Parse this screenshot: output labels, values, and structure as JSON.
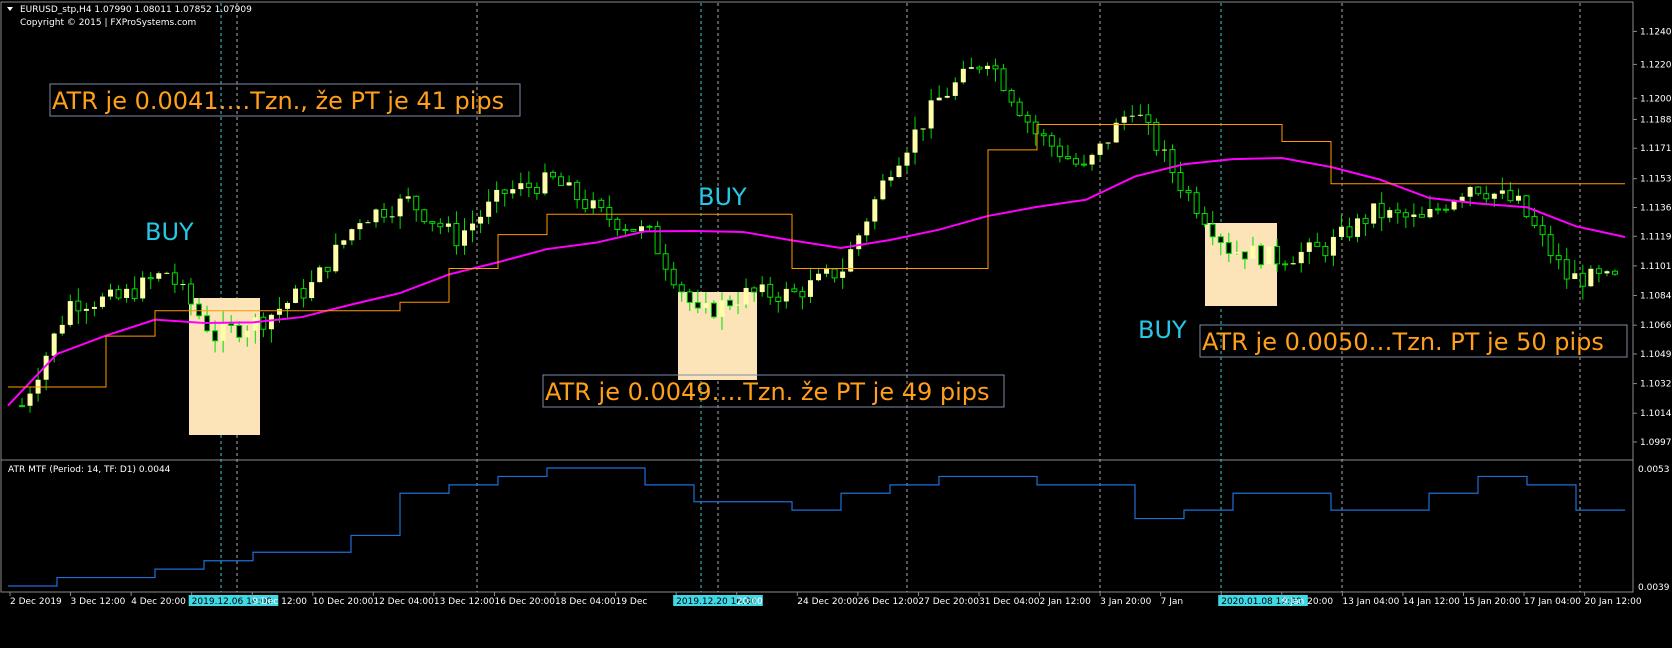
{
  "window": {
    "header": "EURUSD_stp,H4  1.07990 1.08011 1.07852 1.07909",
    "copyright": "Copyright © 2015 | FXProSystems.com"
  },
  "annotations": {
    "atr1": "ATR je 0.0041….Tzn., že PT je 41 pips",
    "atr2": "ATR je 0.0049….Tzn. že PT je 49 pips",
    "atr3": "ATR je 0.0050…Tzn. PT je 50  pips",
    "buy1": "BUY",
    "buy2": "BUY",
    "buy3": "BUY"
  },
  "indicator": {
    "title": "ATR MTF (Period: 14, TF: D1) 0.0044",
    "axis_top": "0.0053",
    "axis_bottom": "0.0039"
  },
  "colors": {
    "background": "#000000",
    "bull_candle": "#ffffaa",
    "wick": "#00dd00",
    "ma_line": "#ff00ff",
    "stop_line": "#ff9900",
    "atr_line": "#1e6fd9",
    "label_orange": "#ff9f1a",
    "label_cyan": "#27c7e8",
    "box_fill": "#fde3b8",
    "grid_cyan": "#3fd0d0",
    "grid_white": "#cccccc"
  },
  "x_axis": {
    "labels": [
      "2 Dec 2019",
      "3 Dec 12:00",
      "4 Dec 20:00",
      "2019.12.06 16:00",
      "9 Dec 12:00",
      "10 Dec 20:00",
      "12 Dec 04:00",
      "13 Dec 12:00",
      "16 Dec 20:00",
      "18 Dec 04:00",
      "19 Dec",
      "2019.12.20 16:00",
      "20:00",
      "24 Dec 20:00",
      "26 Dec 12:00",
      "27 Dec 20:00",
      "31 Dec 04:00",
      "2 Jan 12:00",
      "3 Jan 20:00",
      "7 Jan",
      "2020.01.08 12:00",
      "9 Jan 20:00",
      "13 Jan 04:00",
      "14 Jan 12:00",
      "15 Jan 20:00",
      "17 Jan 04:00",
      "20 Jan 12:00"
    ],
    "highlighted": [
      "2019.12.06 16:00",
      "2019.12.20 16:00",
      "2020.01.08 12:00"
    ]
  },
  "y_axis": {
    "labels": [
      "1.12400",
      "1.12205",
      "1.12005",
      "1.11880",
      "1.11710",
      "1.11530",
      "1.11360",
      "1.11190",
      "1.11015",
      "1.10840",
      "1.10665",
      "1.10495",
      "1.10320",
      "1.10145",
      "1.09975"
    ]
  },
  "chart_data": [
    {
      "type": "line",
      "title": "EURUSD_stp,H4",
      "ylim": [
        1.09975,
        1.1242
      ],
      "series": [
        {
          "name": "close",
          "x": [
            "2 Dec",
            "3 Dec",
            "4 Dec",
            "5 Dec",
            "6 Dec",
            "9 Dec",
            "10 Dec",
            "11 Dec",
            "12 Dec",
            "13 Dec",
            "16 Dec",
            "17 Dec",
            "18 Dec",
            "19 Dec",
            "20 Dec",
            "23 Dec",
            "24 Dec",
            "26 Dec",
            "27 Dec",
            "30 Dec",
            "31 Dec",
            "2 Jan",
            "3 Jan",
            "6 Jan",
            "7 Jan",
            "8 Jan",
            "9 Jan",
            "10 Jan",
            "13 Jan",
            "14 Jan",
            "15 Jan",
            "16 Jan",
            "17 Jan",
            "20 Jan"
          ],
          "values": [
            1.1019,
            1.108,
            1.1082,
            1.1098,
            1.106,
            1.107,
            1.109,
            1.113,
            1.114,
            1.1118,
            1.1145,
            1.1152,
            1.1132,
            1.112,
            1.1072,
            1.1085,
            1.1085,
            1.11,
            1.116,
            1.12,
            1.1225,
            1.118,
            1.1158,
            1.1196,
            1.115,
            1.1112,
            1.1106,
            1.1112,
            1.1133,
            1.1128,
            1.115,
            1.1138,
            1.1095,
            1.1093
          ]
        }
      ]
    },
    {
      "type": "line",
      "title": "ATR MTF (Period: 14, TF: D1) 0.0044",
      "ylim": [
        0.0039,
        0.0053
      ],
      "series": [
        {
          "name": "ATR MTF",
          "x": [
            "2 Dec",
            "3 Dec",
            "4 Dec",
            "5 Dec",
            "6 Dec",
            "9 Dec",
            "10 Dec",
            "11 Dec",
            "12 Dec",
            "13 Dec",
            "16 Dec",
            "17 Dec",
            "18 Dec",
            "19 Dec",
            "20 Dec",
            "23 Dec",
            "24 Dec",
            "26 Dec",
            "27 Dec",
            "30 Dec",
            "31 Dec",
            "2 Jan",
            "3 Jan",
            "6 Jan",
            "7 Jan",
            "8 Jan",
            "9 Jan",
            "10 Jan",
            "13 Jan",
            "14 Jan",
            "15 Jan",
            "16 Jan",
            "17 Jan",
            "20 Jan"
          ],
          "values": [
            0.0039,
            0.004,
            0.004,
            0.0041,
            0.0042,
            0.0043,
            0.0043,
            0.0045,
            0.005,
            0.0051,
            0.0052,
            0.0053,
            0.0053,
            0.0051,
            0.0049,
            0.0049,
            0.0048,
            0.005,
            0.0051,
            0.0052,
            0.0052,
            0.0051,
            0.0051,
            0.0047,
            0.0048,
            0.005,
            0.005,
            0.0048,
            0.0048,
            0.005,
            0.0052,
            0.0051,
            0.0048,
            0.0048
          ]
        }
      ]
    }
  ]
}
